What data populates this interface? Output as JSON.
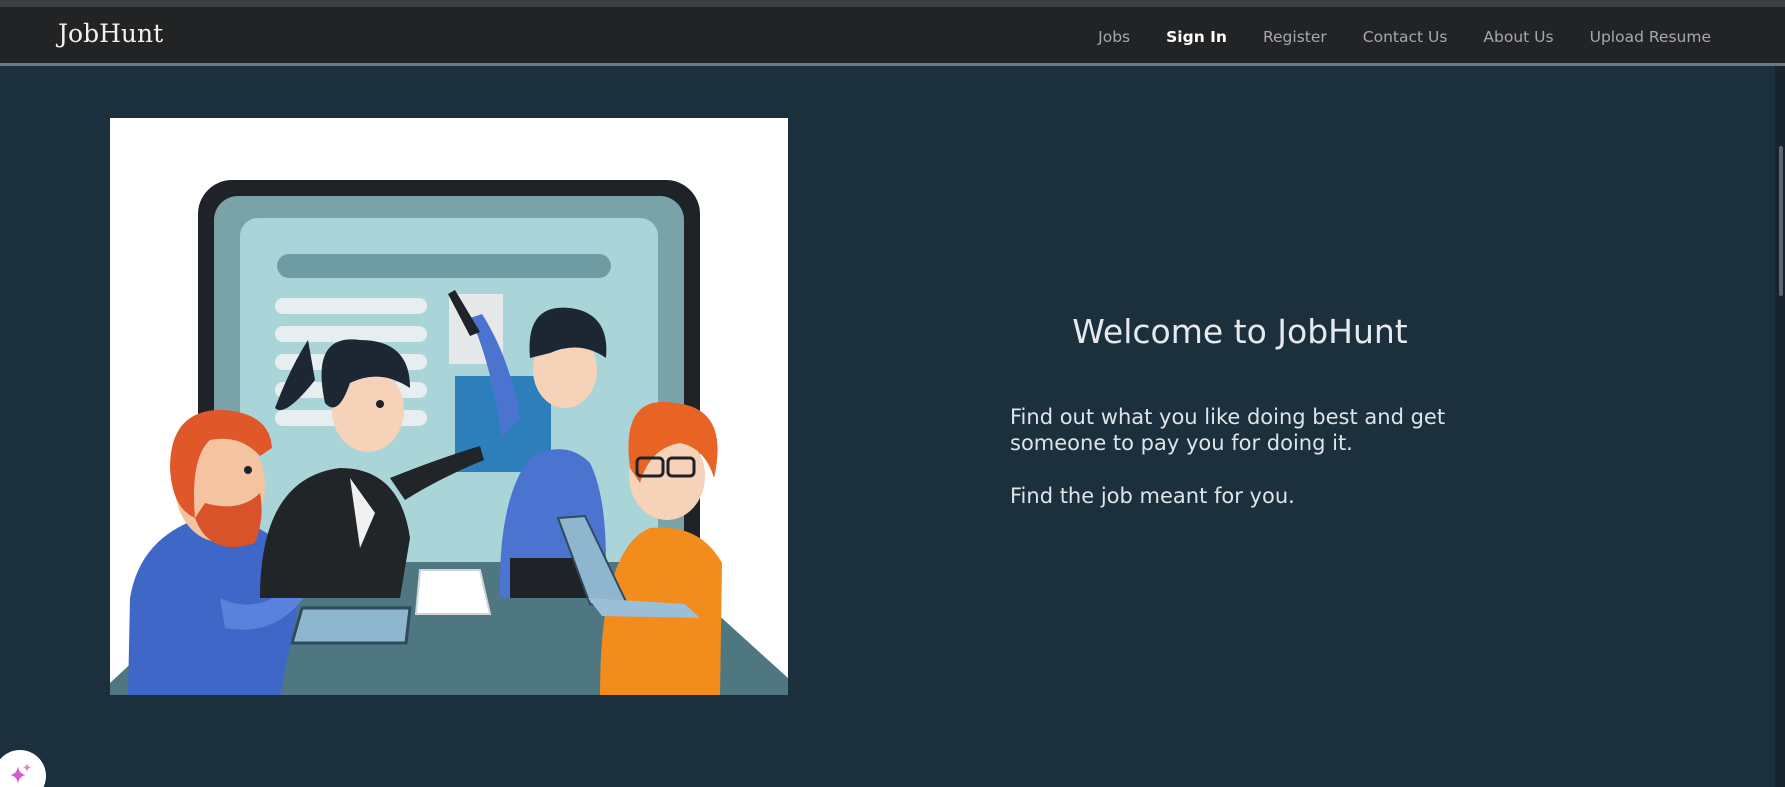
{
  "brand": {
    "name": "JobHunt"
  },
  "nav": {
    "links": [
      {
        "label": "Jobs",
        "active": false
      },
      {
        "label": "Sign In",
        "active": true
      },
      {
        "label": "Register",
        "active": false
      },
      {
        "label": "Contact Us",
        "active": false
      },
      {
        "label": "About Us",
        "active": false
      },
      {
        "label": "Upload Resume",
        "active": false
      }
    ]
  },
  "hero": {
    "title": "Welcome to JobHunt",
    "tagline": "Find out what you like doing best and get someone to pay you for doing it.",
    "subtagline": "Find the job meant for you.",
    "illustration": "team-meeting-illustration"
  },
  "assistant": {
    "icon": "sparkle-icon"
  },
  "colors": {
    "background": "#1b2f3d",
    "navbar": "#222324",
    "nav_text": "#a6a8ab",
    "nav_active": "#ffffff",
    "hero_text": "#e6eaee"
  }
}
